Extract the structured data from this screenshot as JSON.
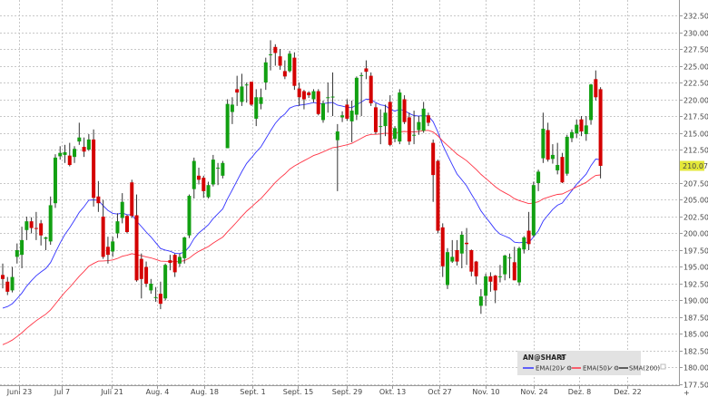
{
  "chart_data": {
    "type": "candlestick",
    "title": "",
    "ylim": [
      177.36,
      234.8
    ],
    "y_ticks": [
      "232.50",
      "230.00",
      "227.50",
      "225.00",
      "222.50",
      "220.00",
      "217.50",
      "215.00",
      "212.50",
      "207.50",
      "205.00",
      "202.50",
      "200.00",
      "197.50",
      "195.00",
      "192.50",
      "190.00",
      "187.50",
      "185.00",
      "182.50",
      "180.00",
      "177.50"
    ],
    "y_tick_values": [
      232.5,
      230,
      227.5,
      225,
      222.5,
      220,
      217.5,
      215,
      212.5,
      207.5,
      205,
      202.5,
      200,
      197.5,
      195,
      192.5,
      190,
      187.5,
      185,
      182.5,
      180,
      177.5
    ],
    "last_price": "210.07",
    "last_price_value": 210.07,
    "x_ticks": [
      "Juni 23",
      "Jul 7",
      "Juli 21",
      "Aug. 4",
      "Aug. 18",
      "Sept. 1",
      "Sept. 15",
      "Sept. 29",
      "Okt. 13",
      "Oct 27",
      "Nov. 10",
      "Nov. 24",
      "Dez. 8",
      "Dez. 22"
    ],
    "x_tick_index": [
      3.4,
      12.4,
      22.8,
      32.3,
      42.2,
      52.2,
      61.7,
      72,
      81.4,
      91.3,
      101,
      111,
      120.5,
      130.5
    ],
    "xlim": [
      -0.57,
      141.4
    ],
    "grid": true,
    "ohlc": [
      [
        193.8,
        195.5,
        191.8,
        193.2
      ],
      [
        192.8,
        193.5,
        190.8,
        191.3
      ],
      [
        191.5,
        195,
        191.2,
        193.5
      ],
      [
        196.5,
        198.5,
        195.5,
        197.5
      ],
      [
        196.8,
        201,
        194.8,
        199
      ],
      [
        200.5,
        202.5,
        199,
        201.8
      ],
      [
        201.8,
        202.4,
        200,
        200.8
      ],
      [
        200.8,
        203.2,
        199,
        200.7
      ],
      [
        201.5,
        202,
        198.2,
        199.7
      ],
      [
        199.2,
        199.5,
        197.5,
        199.4
      ],
      [
        198.8,
        205.5,
        198.3,
        204.2
      ],
      [
        204.5,
        211.8,
        203.8,
        211.3
      ],
      [
        211.5,
        213,
        211,
        212
      ],
      [
        211.7,
        213.2,
        210.5,
        212.1
      ],
      [
        211.6,
        213.5,
        210,
        210.2
      ],
      [
        211.4,
        213,
        210.5,
        212.6
      ],
      [
        213.7,
        216.5,
        213.2,
        214.3
      ],
      [
        212.9,
        214.3,
        211.4,
        212.2
      ],
      [
        212.5,
        214.8,
        212.3,
        214
      ],
      [
        214,
        215.5,
        204,
        205.3
      ],
      [
        205.5,
        207.8,
        203.2,
        204.5
      ],
      [
        202.5,
        205,
        196.2,
        196.5
      ],
      [
        198,
        199.5,
        195.5,
        196.8
      ],
      [
        197.3,
        199.5,
        196.5,
        198.8
      ],
      [
        200,
        203,
        199.3,
        201.8
      ],
      [
        202.3,
        206,
        201.5,
        204.7
      ],
      [
        202.6,
        202.8,
        200,
        200.2
      ],
      [
        207.6,
        208,
        202.3,
        202.6
      ],
      [
        202.7,
        205.8,
        192.8,
        193
      ],
      [
        196.2,
        197,
        190.3,
        193.2
      ],
      [
        195,
        195.8,
        192,
        192.5
      ],
      [
        191.5,
        193.2,
        191,
        192.5
      ],
      [
        190.5,
        192,
        189.8,
        190.5
      ],
      [
        191,
        192.8,
        188.7,
        189.5
      ],
      [
        190.3,
        195.5,
        190,
        195.3
      ],
      [
        196,
        196.8,
        194.5,
        195.6
      ],
      [
        196.8,
        197,
        193.5,
        194.2
      ],
      [
        195.5,
        197,
        195,
        196.5
      ],
      [
        196.3,
        199.5,
        195.5,
        199.4
      ],
      [
        199.7,
        205.8,
        199.3,
        205.6
      ],
      [
        206.6,
        211.3,
        205.2,
        210.8
      ],
      [
        208.6,
        209.8,
        207.3,
        208
      ],
      [
        208.3,
        208.6,
        205.3,
        206.3
      ],
      [
        205.4,
        207.7,
        205.2,
        207.2
      ],
      [
        207.3,
        211.7,
        207,
        211
      ],
      [
        209.7,
        210.5,
        207.2,
        209.8
      ],
      [
        208.6,
        210.8,
        208.2,
        210.5
      ],
      [
        212.7,
        220,
        212.7,
        219.3
      ],
      [
        218.1,
        220.3,
        216.3,
        219.2
      ],
      [
        221.5,
        223.5,
        219,
        221
      ],
      [
        219.6,
        223.8,
        219,
        221.9
      ],
      [
        222.1,
        222.5,
        219.5,
        222.2
      ],
      [
        222.6,
        222.6,
        219,
        219.2
      ],
      [
        217.1,
        221.5,
        216,
        220.3
      ],
      [
        219.3,
        221.6,
        218.5,
        220.3
      ],
      [
        222.5,
        226.2,
        221.4,
        225.5
      ],
      [
        226.6,
        228.8,
        224.3,
        226.7
      ],
      [
        227.8,
        228.2,
        225,
        226.9
      ],
      [
        226.4,
        227.5,
        224.4,
        225
      ],
      [
        224.2,
        225.8,
        223,
        223.4
      ],
      [
        224.2,
        227.2,
        224,
        226.8
      ],
      [
        226.2,
        227,
        221.4,
        222
      ],
      [
        221.6,
        222.5,
        219,
        220.3
      ],
      [
        221.2,
        221.4,
        218.5,
        220
      ],
      [
        221,
        221.2,
        220.2,
        220.6
      ],
      [
        220,
        221.5,
        219.5,
        221.2
      ],
      [
        221.2,
        221.5,
        217.6,
        217.8
      ],
      [
        216.9,
        219.8,
        216.5,
        219.4
      ],
      [
        220.2,
        222.5,
        218,
        220.3
      ],
      [
        220.3,
        224,
        217.5,
        220.4
      ],
      [
        213.9,
        216.3,
        206.3,
        215.2
      ],
      [
        217.3,
        218.2,
        216.6,
        217.6
      ],
      [
        219.2,
        220,
        216.8,
        217.1
      ],
      [
        216.7,
        219.8,
        213.6,
        218.3
      ],
      [
        217.7,
        223.4,
        216.9,
        223.2
      ],
      [
        223.6,
        224,
        217.5,
        223.6
      ],
      [
        224.6,
        225.8,
        223,
        224.1
      ],
      [
        223.5,
        224,
        219,
        219.4
      ],
      [
        218.8,
        219.4,
        214.8,
        215.1
      ],
      [
        216,
        218.5,
        213.3,
        216
      ],
      [
        216,
        219.2,
        214.5,
        218
      ],
      [
        219.6,
        220.6,
        213,
        213.2
      ],
      [
        214.1,
        216,
        213.6,
        215.7
      ],
      [
        213.7,
        221.5,
        213.3,
        221
      ],
      [
        220,
        220.6,
        216.3,
        216.6
      ],
      [
        217.3,
        218,
        213.2,
        213.7
      ],
      [
        214.7,
        218.3,
        213.3,
        214.7
      ],
      [
        215.4,
        217.5,
        214.7,
        216.6
      ],
      [
        215.3,
        219.6,
        215,
        218.6
      ],
      [
        217.6,
        218,
        216,
        216.5
      ],
      [
        213.5,
        214,
        204.7,
        208.7
      ],
      [
        210.8,
        211,
        200,
        200.4
      ],
      [
        200.9,
        201.5,
        193.5,
        195.1
      ],
      [
        192.3,
        197.8,
        191.7,
        197.2
      ],
      [
        195.8,
        199,
        195.6,
        196.5
      ],
      [
        197.5,
        199,
        195.2,
        195.8
      ],
      [
        197,
        200.3,
        194.8,
        199.8
      ],
      [
        198.6,
        200.8,
        195.3,
        198.4
      ],
      [
        197.5,
        197.6,
        193.6,
        194.3
      ],
      [
        195.8,
        195.9,
        192.4,
        193.6
      ],
      [
        189.2,
        191.7,
        188,
        190.6
      ],
      [
        190.7,
        194,
        189.2,
        193.6
      ],
      [
        193.6,
        194.2,
        191.3,
        192.8
      ],
      [
        193.7,
        193.8,
        189.6,
        191.5
      ],
      [
        193.6,
        195.3,
        192.7,
        193.6
      ],
      [
        193.9,
        196.8,
        193,
        196.7
      ],
      [
        196.4,
        197,
        193.3,
        196.4
      ],
      [
        195.7,
        198,
        193,
        193
      ],
      [
        192.7,
        198,
        192.2,
        197.8
      ],
      [
        197.6,
        199.6,
        197,
        199.4
      ],
      [
        200.4,
        203.2,
        197.5,
        198.4
      ],
      [
        199.7,
        207.7,
        199.5,
        207.2
      ],
      [
        207.5,
        209.5,
        206.3,
        209.2
      ],
      [
        211.2,
        218,
        210.5,
        215.6
      ],
      [
        215.4,
        216.5,
        210.7,
        211
      ],
      [
        211.1,
        213.3,
        210.4,
        211.7
      ],
      [
        209.4,
        213.5,
        208.8,
        210.2
      ],
      [
        211.4,
        212,
        207.5,
        207.6
      ],
      [
        208.9,
        214.7,
        208.6,
        214.4
      ],
      [
        214.2,
        215.5,
        213.6,
        215.1
      ],
      [
        214.9,
        217,
        214.2,
        216.2
      ],
      [
        217,
        217.5,
        214.5,
        215.2
      ],
      [
        214.8,
        217.5,
        213.8,
        216.1
      ],
      [
        216.9,
        222.3,
        216.2,
        222.2
      ],
      [
        223,
        224.3,
        219.8,
        220.3
      ],
      [
        221.5,
        221.8,
        208.2,
        210.07
      ]
    ],
    "indicators": [
      {
        "name": "EMA(20)",
        "period": 20,
        "seed": 188.4,
        "color": "#3333ff",
        "enabled": true
      },
      {
        "name": "EMA(50)",
        "period": 50,
        "seed": 183.0,
        "color": "#ff3344",
        "enabled": true
      },
      {
        "name": "SMA(200)",
        "period": 200,
        "color": "#333333",
        "enabled": false
      }
    ],
    "colors": {
      "up": "#12a012",
      "down": "#d40000",
      "wick": "#333333",
      "grid": "#c8c8c8",
      "last_price_bg": "#e4e83a"
    }
  },
  "legend": {
    "title": "AN@SHART",
    "items": [
      "EMA(20)",
      "EMA(50)",
      "SMA(200)"
    ]
  }
}
